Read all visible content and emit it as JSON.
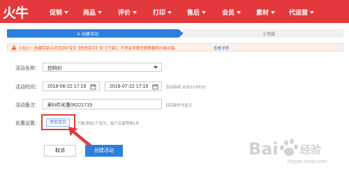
{
  "brand": {
    "logo": "火牛"
  },
  "nav": {
    "items": [
      {
        "label": "促销"
      },
      {
        "label": "商品"
      },
      {
        "label": "评价"
      },
      {
        "label": "打印"
      },
      {
        "label": "售后"
      },
      {
        "label": "会员"
      },
      {
        "label": "素材"
      },
      {
        "label": "代运营"
      }
    ]
  },
  "steps": [
    {
      "label": "① 创建活动",
      "state": "active"
    },
    {
      "label": "2  完成",
      "state": "pending"
    }
  ],
  "warning": {
    "text": "小贴士：创建后禁止对活动中宝贝【修改库存】和【下架】，不然会导致优惠数量和价格出错。",
    "link": "查看详情"
  },
  "form": {
    "name_label": "活动名称：",
    "name_value": "拍购价",
    "time_label": "活动时间：",
    "start_value": "2018-06-22 17:19",
    "end_value": "2018-07-22 17:19",
    "time_hint": "活动持续 30天0小时0分",
    "note_label": "活动备注：",
    "note_value": "刷N件优惠06221719",
    "note_hint": "日后软件内显示",
    "setting_label": "优惠设置：",
    "add_button": "添加宝贝",
    "add_hint": "只能添加1个宝贝，每个买家限购1件"
  },
  "actions": {
    "cancel": "取消",
    "create": "创建活动"
  },
  "watermark": {
    "text": "jingyan.baidu.com"
  },
  "colors": {
    "brand_red": "#e4393c",
    "primary_blue": "#2e7fd9",
    "warning_orange": "#e45b2a",
    "highlight_red": "#e03a3a"
  }
}
